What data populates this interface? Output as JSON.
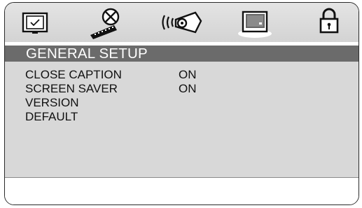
{
  "icons": [
    {
      "name": "tv-display-icon"
    },
    {
      "name": "video-film-icon"
    },
    {
      "name": "speaker-audio-icon"
    },
    {
      "name": "general-setup-icon"
    },
    {
      "name": "lock-icon"
    }
  ],
  "title": "GENERAL SETUP",
  "items": [
    {
      "label": "CLOSE CAPTION",
      "value": "ON"
    },
    {
      "label": "SCREEN SAVER",
      "value": "ON"
    },
    {
      "label": "VERSION",
      "value": ""
    },
    {
      "label": "DEFAULT",
      "value": ""
    }
  ],
  "status": ""
}
